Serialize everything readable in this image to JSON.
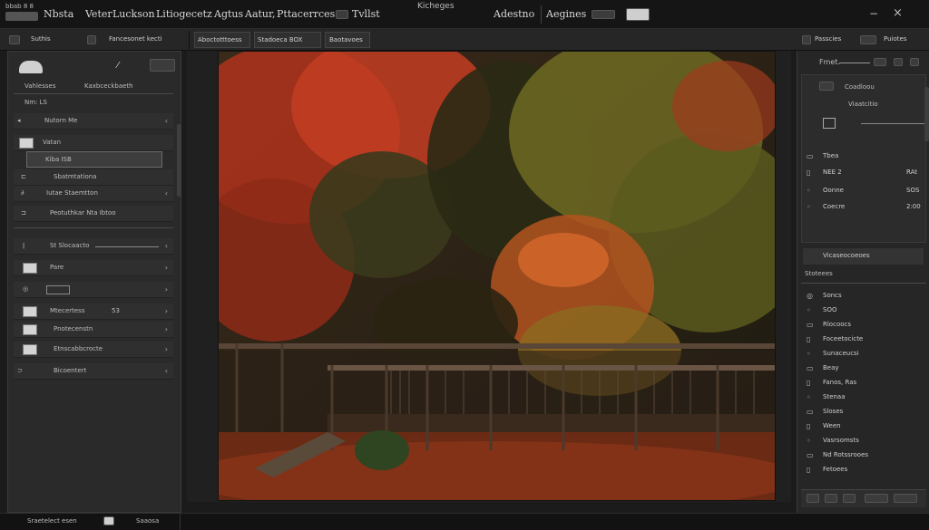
{
  "menubar": {
    "app_label": "bbab 8 8",
    "items": [
      "Nbsta",
      "Veter",
      "Luckson",
      "Litiogecetz",
      "Agtus",
      "Aatur,",
      "Pttacerrces",
      "Tvllst"
    ],
    "center_title": "Kicheges",
    "right_app": "Adestno",
    "right_mode": "Aegines",
    "close_glyph": "×"
  },
  "toolbar": {
    "left_a": "Suthis",
    "left_b": "Fancesonet kecti",
    "mid_a": "Aboctotttoess",
    "mid_b": "Stadoeca BOX",
    "mid_c": "Baotavoes",
    "right_a": "Passcies",
    "right_b": "Puiotes"
  },
  "left_panel": {
    "row_labels": [
      "Vahlesses",
      "Kaxbceckbaeth",
      "Nm: LS"
    ],
    "items": [
      {
        "label": "Nutorn Me",
        "arrow": "‹"
      },
      {
        "label": "Vatan",
        "arrow": ""
      },
      {
        "label": "Kiba  ISB",
        "arrow": ""
      },
      {
        "label": "Sbatmtationa",
        "arrow": ""
      },
      {
        "label": "Iutae Staemtton",
        "arrow": "‹"
      },
      {
        "label": "Peotuthkar Nta Ibtoo",
        "arrow": ""
      },
      {
        "label": "St Slocaacto",
        "arrow": "‹"
      },
      {
        "label": "Pare",
        "arrow": "›"
      },
      {
        "label": "",
        "arrow": "›"
      },
      {
        "label": "Mtecertess",
        "value": "53",
        "arrow": "›"
      },
      {
        "label": "Pnotecenstn",
        "arrow": "›"
      },
      {
        "label": "Etnscabbcrocte",
        "arrow": "›"
      },
      {
        "label": "Bicoentert",
        "arrow": "‹"
      }
    ]
  },
  "right_panel": {
    "header_a": "Fmet.",
    "header_b": "Coadloou",
    "header_c": "Viaatcitio",
    "fields": [
      {
        "label": "Tbea",
        "value": ""
      },
      {
        "label": "NEE 2",
        "value": "RAt"
      },
      {
        "label": "Oonne",
        "value": "SOS"
      },
      {
        "label": "Coecre",
        "value": "2:00"
      }
    ],
    "section": "Vicaseocoeoes",
    "section2": "Stoteees",
    "list": [
      "Soncs",
      "SOO",
      "Rlocoocs",
      "Foceetocicte",
      "Sunaceucsi",
      "Beay",
      "Fanos, Ras",
      "Stenaa",
      "Sloses",
      "Ween",
      "Vasrsomsts",
      "Nd Rotssrooes",
      "Fetoees"
    ]
  },
  "statusbar": {
    "left": "Sraetelect esen",
    "right": "Saaosa"
  }
}
